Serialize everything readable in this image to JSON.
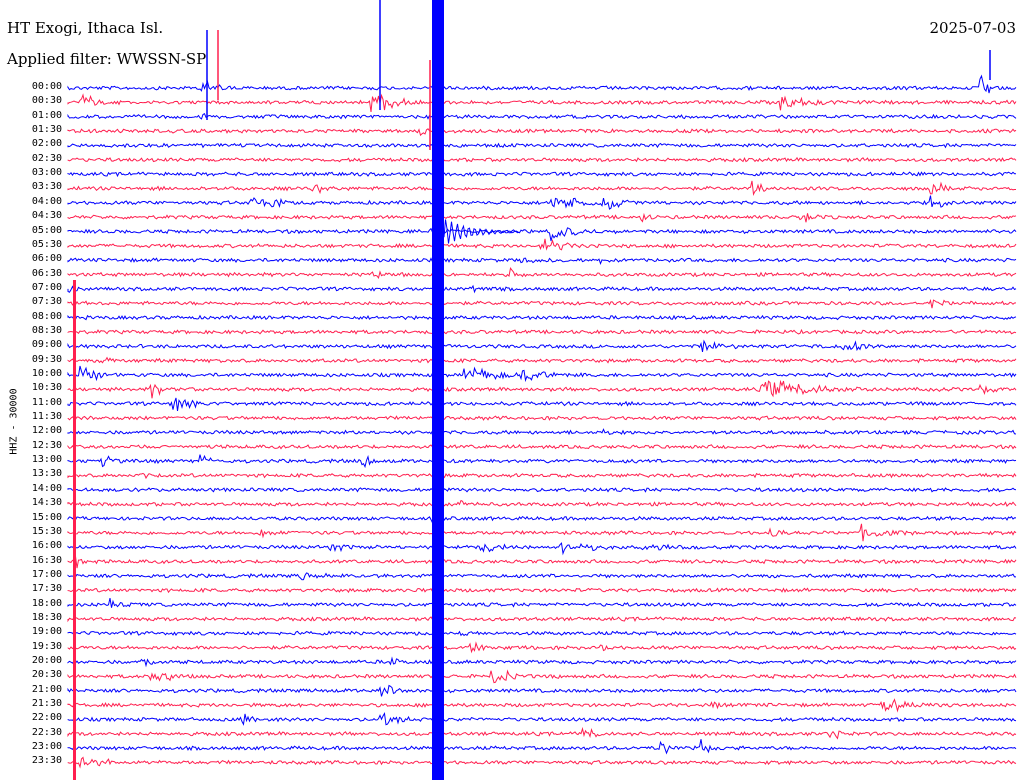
{
  "header": {
    "station": "HT Exogi, Ithaca Isl.",
    "date": "2025-07-03",
    "filter": "Applied filter: WWSSN-SP"
  },
  "channel_label": "HHZ - 30000",
  "colors": {
    "odd_trace": "#0000ff",
    "even_trace": "#ff1f4f",
    "background": "#ffffff"
  },
  "chart_data": {
    "type": "line",
    "title": "HT Exogi, Ithaca Isl.",
    "ylabel": "HHZ - 30000",
    "rows": [
      "00:00",
      "00:30",
      "01:00",
      "01:30",
      "02:00",
      "02:30",
      "03:00",
      "03:30",
      "04:00",
      "04:30",
      "05:00",
      "05:30",
      "06:00",
      "06:30",
      "07:00",
      "07:30",
      "08:00",
      "08:30",
      "09:00",
      "09:30",
      "10:00",
      "10:30",
      "11:00",
      "11:30",
      "12:00",
      "12:30",
      "13:00",
      "13:30",
      "14:00",
      "14:30",
      "15:00",
      "15:30",
      "16:00",
      "16:30",
      "17:00",
      "17:30",
      "18:00",
      "18:30",
      "19:00",
      "19:30",
      "20:00",
      "20:30",
      "21:00",
      "21:30",
      "22:00",
      "22:30",
      "23:00",
      "23:30"
    ],
    "row_colors": [
      "blue",
      "red",
      "blue",
      "red",
      "blue",
      "red",
      "blue",
      "red",
      "blue",
      "red",
      "blue",
      "red",
      "blue",
      "red",
      "blue",
      "red",
      "blue",
      "red",
      "blue",
      "red",
      "blue",
      "red",
      "blue",
      "red",
      "blue",
      "red",
      "blue",
      "red",
      "blue",
      "red",
      "blue",
      "red",
      "blue",
      "red",
      "blue",
      "red",
      "blue",
      "red",
      "blue",
      "red",
      "blue",
      "red",
      "blue",
      "red",
      "blue",
      "red",
      "blue",
      "red"
    ],
    "x_minutes_per_row": 30,
    "grid": false,
    "legend": "none"
  }
}
